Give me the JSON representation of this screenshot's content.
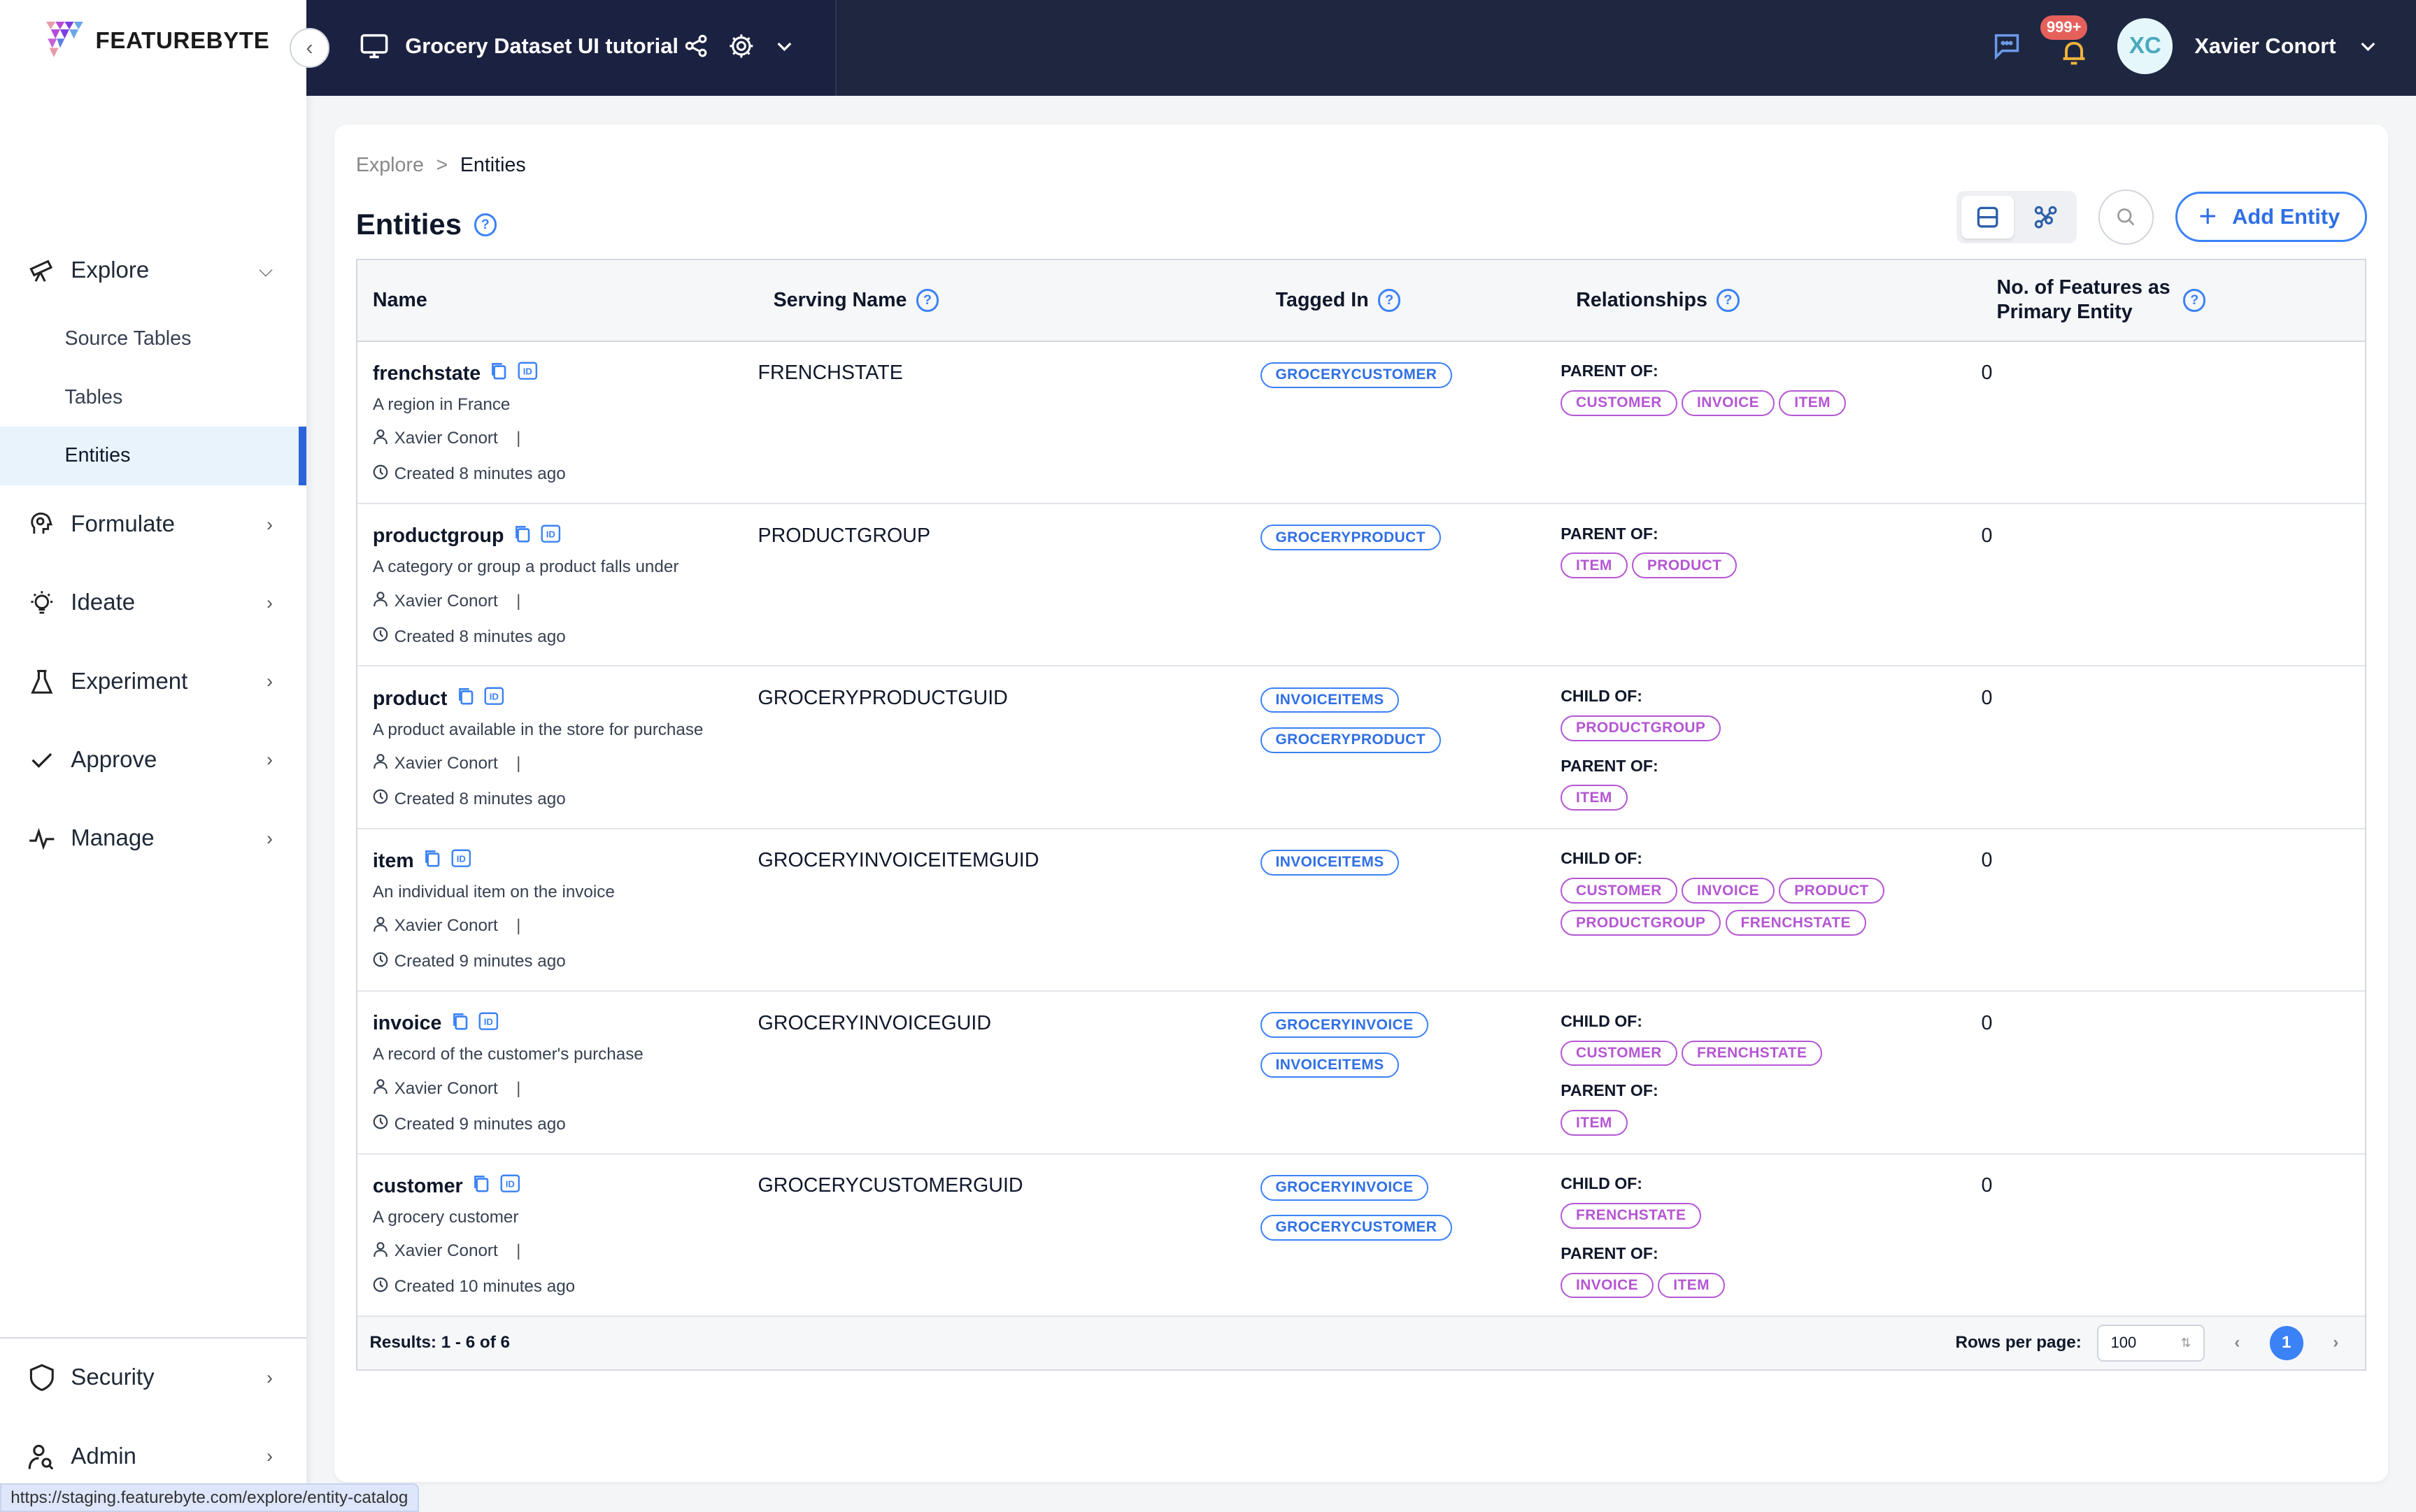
{
  "app": {
    "brand": "FEATUREBYTE",
    "project_title": "Grocery Dataset UI tutorial",
    "notifications_count": "999+",
    "user_initials": "XC",
    "user_name": "Xavier Conort",
    "status_url": "https://staging.featurebyte.com/explore/entity-catalog",
    "colors": {
      "topbar": "#1e2640",
      "accent": "#3b82f6",
      "relationship_tag": "#b556d3",
      "active_nav": "#2b64d9"
    }
  },
  "sidebar": {
    "items": [
      {
        "label": "Explore",
        "icon": "telescope-icon",
        "expanded": true,
        "children": [
          {
            "label": "Source Tables"
          },
          {
            "label": "Tables"
          },
          {
            "label": "Entities",
            "active": true
          }
        ]
      },
      {
        "label": "Formulate",
        "icon": "head-gear-icon"
      },
      {
        "label": "Ideate",
        "icon": "lightbulb-icon"
      },
      {
        "label": "Experiment",
        "icon": "flask-icon"
      },
      {
        "label": "Approve",
        "icon": "check-icon"
      },
      {
        "label": "Manage",
        "icon": "pulse-icon"
      }
    ],
    "bottom_items": [
      {
        "label": "Security",
        "icon": "shield-icon"
      },
      {
        "label": "Admin",
        "icon": "user-search-icon"
      }
    ]
  },
  "main": {
    "breadcrumb": {
      "parent": "Explore",
      "separator": ">",
      "current": "Entities"
    },
    "title": "Entities",
    "add_button": "Add Entity",
    "table": {
      "columns": [
        "Name",
        "Serving Name",
        "Tagged In",
        "Relationships",
        "No. of Features as Primary Entity"
      ],
      "rows": [
        {
          "name": "frenchstate",
          "description": "A region in France",
          "owner": "Xavier Conort",
          "created": "Created 8 minutes ago",
          "serving_name": "FRENCHSTATE",
          "tagged_in": [
            "GROCERYCUSTOMER"
          ],
          "relationships": [
            {
              "label": "PARENT OF:",
              "entities": [
                "CUSTOMER",
                "INVOICE",
                "ITEM"
              ]
            }
          ],
          "features": "0"
        },
        {
          "name": "productgroup",
          "description": "A category or group a product falls under",
          "owner": "Xavier Conort",
          "created": "Created 8 minutes ago",
          "serving_name": "PRODUCTGROUP",
          "tagged_in": [
            "GROCERYPRODUCT"
          ],
          "relationships": [
            {
              "label": "PARENT OF:",
              "entities": [
                "ITEM",
                "PRODUCT"
              ]
            }
          ],
          "features": "0"
        },
        {
          "name": "product",
          "description": "A product available in the store for purchase",
          "owner": "Xavier Conort",
          "created": "Created 8 minutes ago",
          "serving_name": "GROCERYPRODUCTGUID",
          "tagged_in": [
            "INVOICEITEMS",
            "GROCERYPRODUCT"
          ],
          "relationships": [
            {
              "label": "CHILD OF:",
              "entities": [
                "PRODUCTGROUP"
              ]
            },
            {
              "label": "PARENT OF:",
              "entities": [
                "ITEM"
              ]
            }
          ],
          "features": "0"
        },
        {
          "name": "item",
          "description": "An individual item on the invoice",
          "owner": "Xavier Conort",
          "created": "Created 9 minutes ago",
          "serving_name": "GROCERYINVOICEITEMGUID",
          "tagged_in": [
            "INVOICEITEMS"
          ],
          "relationships": [
            {
              "label": "CHILD OF:",
              "entities": [
                "CUSTOMER",
                "INVOICE",
                "PRODUCT",
                "PRODUCTGROUP",
                "FRENCHSTATE"
              ]
            }
          ],
          "features": "0"
        },
        {
          "name": "invoice",
          "description": "A record of the customer's purchase",
          "owner": "Xavier Conort",
          "created": "Created 9 minutes ago",
          "serving_name": "GROCERYINVOICEGUID",
          "tagged_in": [
            "GROCERYINVOICE",
            "INVOICEITEMS"
          ],
          "relationships": [
            {
              "label": "CHILD OF:",
              "entities": [
                "CUSTOMER",
                "FRENCHSTATE"
              ]
            },
            {
              "label": "PARENT OF:",
              "entities": [
                "ITEM"
              ]
            }
          ],
          "features": "0"
        },
        {
          "name": "customer",
          "description": "A grocery customer",
          "owner": "Xavier Conort",
          "created": "Created 10 minutes ago",
          "serving_name": "GROCERYCUSTOMERGUID",
          "tagged_in": [
            "GROCERYINVOICE",
            "GROCERYCUSTOMER"
          ],
          "relationships": [
            {
              "label": "CHILD OF:",
              "entities": [
                "FRENCHSTATE"
              ]
            },
            {
              "label": "PARENT OF:",
              "entities": [
                "INVOICE",
                "ITEM"
              ]
            }
          ],
          "features": "0"
        }
      ],
      "footer": {
        "results": "Results: 1 - 6 of 6",
        "rows_per_page_label": "Rows per page:",
        "rows_per_page": "100",
        "current_page": "1"
      }
    }
  }
}
